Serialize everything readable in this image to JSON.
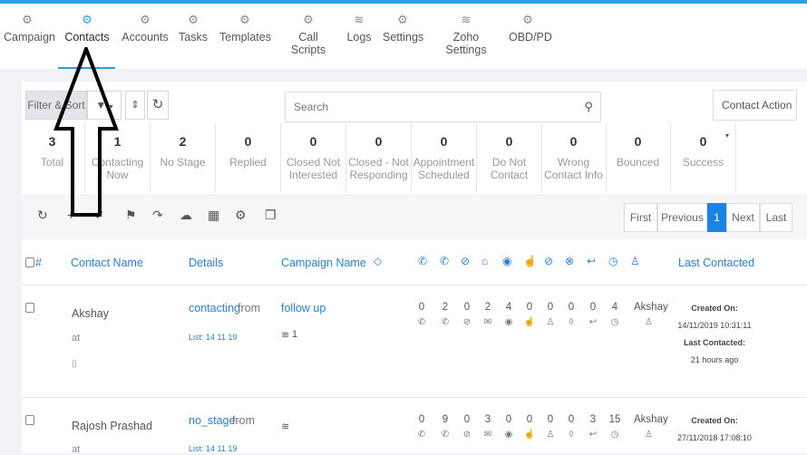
{
  "nav": {
    "items": [
      {
        "label": "Campaign",
        "icon": "gear-icon"
      },
      {
        "label": "Contacts",
        "icon": "gear-icon"
      },
      {
        "label": "Accounts",
        "icon": "gear-icon"
      },
      {
        "label": "Tasks",
        "icon": "gear-icon"
      },
      {
        "label": "Templates",
        "icon": "gear-icon"
      },
      {
        "label": "Call Scripts",
        "icon": "gear-icon"
      },
      {
        "label": "Logs",
        "icon": "layers-icon"
      },
      {
        "label": "Settings",
        "icon": "gear-icon"
      },
      {
        "label": "Zoho Settings",
        "icon": "layers-icon"
      },
      {
        "label": "OBD/PD",
        "icon": "gear-icon"
      }
    ],
    "active": "Contacts"
  },
  "controls": {
    "filter_label": "Filter & Sort",
    "search_placeholder": "Search",
    "contact_action_label": "Contact Action"
  },
  "stats": [
    {
      "num": "3",
      "label": "Total"
    },
    {
      "num": "1",
      "label": "Contacting Now"
    },
    {
      "num": "2",
      "label": "No Stage"
    },
    {
      "num": "0",
      "label": "Replied"
    },
    {
      "num": "0",
      "label": "Closed Not Interested"
    },
    {
      "num": "0",
      "label": "Closed - Not Responding"
    },
    {
      "num": "0",
      "label": "Appointment Scheduled"
    },
    {
      "num": "0",
      "label": "Do Not Contact"
    },
    {
      "num": "0",
      "label": "Wrong Contact Info"
    },
    {
      "num": "0",
      "label": "Bounced"
    },
    {
      "num": "0",
      "label": "Success"
    }
  ],
  "pager": {
    "first": "First",
    "previous": "Previous",
    "current": "1",
    "next": "Next",
    "last": "Last"
  },
  "table": {
    "headers": {
      "hash": "#",
      "contact_name": "Contact Name",
      "details": "Details",
      "campaign_name": "Campaign Name",
      "last_contacted": "Last Contacted"
    },
    "rows": [
      {
        "name": "Akshay",
        "at": "at",
        "details_link": "contacting",
        "details_text": "from",
        "list": "List: 14 11 19",
        "campaign": "follow up",
        "campaign_count": "1",
        "counts": [
          "0",
          "2",
          "0",
          "2",
          "4",
          "0",
          "0",
          "0",
          "0",
          "4"
        ],
        "owner": "Akshay",
        "created_label": "Created On:",
        "created": "14/11/2019 10:31:11",
        "last_label": "Last Contacted:",
        "last": "21 hours ago"
      },
      {
        "name": "Rajosh Prashad",
        "at": "at",
        "details_link": "no_stage",
        "details_text": "from",
        "list": "List: 14 11 19",
        "campaign": "",
        "campaign_count": "",
        "counts": [
          "0",
          "9",
          "0",
          "3",
          "0",
          "0",
          "0",
          "0",
          "3",
          "15"
        ],
        "owner": "Akshay",
        "created_label": "Created On:",
        "created": "27/11/2018 17:08:10",
        "last_label": "",
        "last": ""
      }
    ]
  },
  "colors": {
    "accent": "#2b9fe6",
    "link": "#2a7fd4",
    "active_page": "#1a83e6"
  }
}
